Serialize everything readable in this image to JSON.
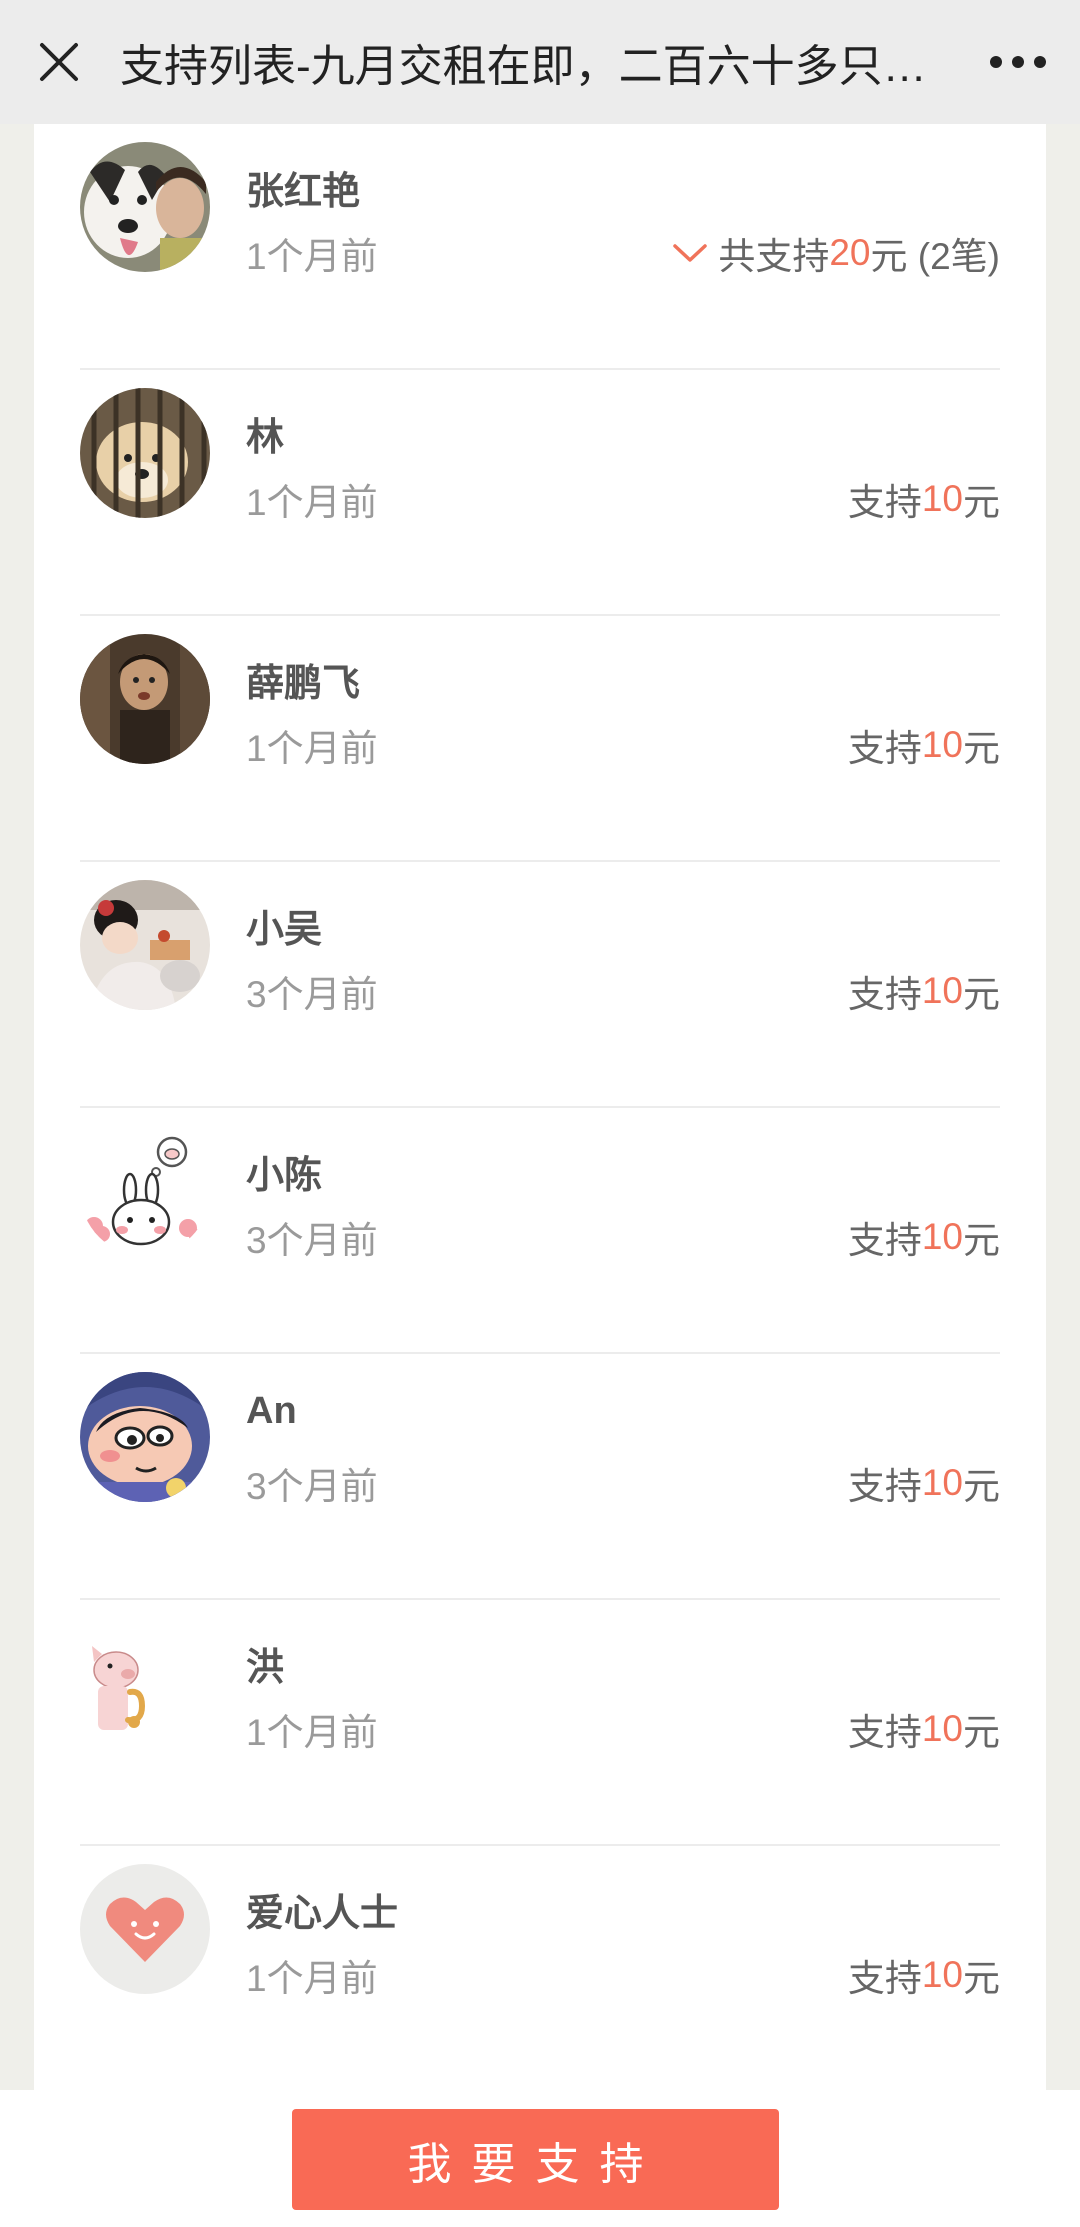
{
  "header": {
    "title": "支持列表-九月交租在即，二百六十多只…"
  },
  "supporters": [
    {
      "name": "张红艳",
      "time": "1个月前",
      "amount_prefix": "共支持",
      "amount_value": "20",
      "amount_suffix": "元 (2笔)",
      "expandable": true
    },
    {
      "name": "林",
      "time": "1个月前",
      "amount_prefix": "支持",
      "amount_value": "10",
      "amount_suffix": "元"
    },
    {
      "name": "薛鹏飞",
      "time": "1个月前",
      "amount_prefix": "支持",
      "amount_value": "10",
      "amount_suffix": "元"
    },
    {
      "name": "小吴",
      "time": "3个月前",
      "amount_prefix": "支持",
      "amount_value": "10",
      "amount_suffix": "元"
    },
    {
      "name": "小陈",
      "time": "3个月前",
      "amount_prefix": "支持",
      "amount_value": "10",
      "amount_suffix": "元"
    },
    {
      "name": "An",
      "time": "3个月前",
      "amount_prefix": "支持",
      "amount_value": "10",
      "amount_suffix": "元"
    },
    {
      "name": "洪",
      "time": "1个月前",
      "amount_prefix": "支持",
      "amount_value": "10",
      "amount_suffix": "元"
    },
    {
      "name": "爱心人士",
      "time": "1个月前",
      "amount_prefix": "支持",
      "amount_value": "10",
      "amount_suffix": "元"
    }
  ],
  "footer": {
    "support_label": "我要支持"
  },
  "colors": {
    "accent": "#f96a55",
    "amount_highlight": "#f0735a"
  }
}
